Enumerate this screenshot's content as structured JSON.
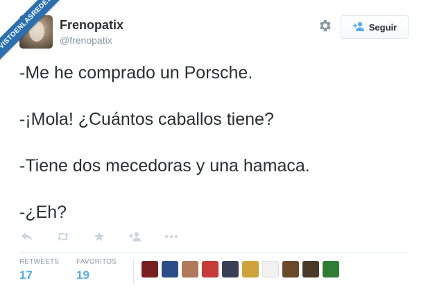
{
  "watermark": {
    "text": "VISTOENLASREDES"
  },
  "user": {
    "name": "Frenopatix",
    "handle": "@frenopatix"
  },
  "follow_button": {
    "label": "Seguir"
  },
  "tweet": {
    "lines": [
      "-Me he comprado un Porsche.",
      "-¡Mola! ¿Cuántos caballos tiene?",
      "-Tiene dos mecedoras y una hamaca.",
      "-¿Eh?"
    ]
  },
  "stats": {
    "retweets_label": "RETWEETS",
    "retweets_value": "17",
    "favorites_label": "FAVORITOS",
    "favorites_value": "19"
  },
  "colors": {
    "accent": "#55acee",
    "text": "#292f33",
    "muted": "#8899a6",
    "icon": "#ccd6dd"
  },
  "faces": [
    {
      "name": "favoriter-avatar-1",
      "color": "#7a1f1f"
    },
    {
      "name": "favoriter-avatar-2",
      "color": "#2c4f8a"
    },
    {
      "name": "favoriter-avatar-3",
      "color": "#b07a5a"
    },
    {
      "name": "favoriter-avatar-4",
      "color": "#c83a3a"
    },
    {
      "name": "favoriter-avatar-5",
      "color": "#3a3f55"
    },
    {
      "name": "favoriter-avatar-6",
      "color": "#d0a23a"
    },
    {
      "name": "favoriter-avatar-7",
      "color": "#f2f2f2"
    },
    {
      "name": "favoriter-avatar-8",
      "color": "#6b4a2c"
    },
    {
      "name": "favoriter-avatar-9",
      "color": "#4a3a2a"
    },
    {
      "name": "favoriter-avatar-10",
      "color": "#2e7d32"
    }
  ]
}
